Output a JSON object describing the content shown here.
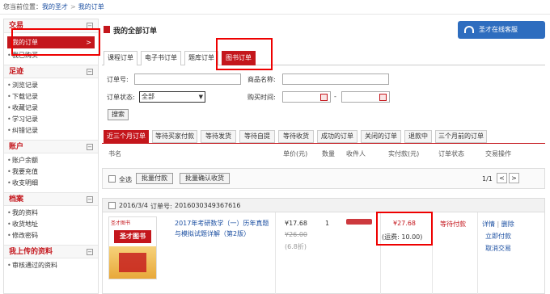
{
  "breadcrumb": {
    "prefix": "您当前位置：",
    "home": "我的圣才",
    "sep": ">",
    "current": "我的订单"
  },
  "sidebar": {
    "sections": [
      {
        "title": "交易",
        "toggle": "⊟",
        "items": [
          {
            "label": "我的订单",
            "active": true,
            "arrow": ">"
          },
          {
            "label": "我已购买"
          }
        ]
      },
      {
        "title": "足迹",
        "toggle": "⊟",
        "items": [
          {
            "label": "浏览记录"
          },
          {
            "label": "下载记录"
          },
          {
            "label": "收藏记录"
          },
          {
            "label": "学习记录"
          },
          {
            "label": "纠错记录"
          }
        ]
      },
      {
        "title": "账户",
        "toggle": "⊟",
        "items": [
          {
            "label": "账户余额"
          },
          {
            "label": "我要充值"
          },
          {
            "label": "收支明细"
          }
        ]
      },
      {
        "title": "档案",
        "toggle": "⊟",
        "items": [
          {
            "label": "我的资料"
          },
          {
            "label": "收货地址"
          },
          {
            "label": "修改密码"
          }
        ]
      },
      {
        "title": "我上传的资料",
        "toggle": "⊟",
        "items": [
          {
            "label": "审核通过的资料"
          }
        ]
      }
    ]
  },
  "main": {
    "title": "我的全部订单",
    "service_button": "圣才在线客服",
    "type_tabs": [
      "课程订单",
      "电子书订单",
      "题库订单",
      "图书订单"
    ],
    "filters": {
      "order_no_label": "订单号:",
      "product_name_label": "商品名称:",
      "status_label": "订单状态:",
      "status_value": "全部",
      "buy_time_label": "购买时间:",
      "range_sep": "-",
      "search_button": "搜索"
    },
    "order_tabs": [
      "近三个月订单",
      "等待买家付款",
      "等待发货",
      "等待自提",
      "等待收货",
      "成功的订单",
      "关闭的订单",
      "退款中",
      "三个月前的订单"
    ],
    "columns": [
      "书名",
      "单价(元)",
      "数量",
      "收件人",
      "实付款(元)",
      "订单状态",
      "交易操作"
    ],
    "batch": {
      "select_all": "全选",
      "batch_pay": "批量付款",
      "batch_confirm": "批量确认收货",
      "page": "1/1",
      "prev": "<",
      "next": ">"
    },
    "order": {
      "date": "2016/3/4",
      "order_no_label": "订单号:",
      "order_no": "2016030349367616",
      "book_cover_logo": "圣才图书",
      "book_cover_title": "圣才图书",
      "book_title": "2017年考研数学（一）历年真题与模拟试题详解（第2版）",
      "price": "¥17.68",
      "orig_price": "¥26.00",
      "discount": "(6.8折)",
      "qty": "1",
      "paid": "¥27.68",
      "shipping": "(运费: 10.00)",
      "status": "等待付款",
      "actions": {
        "detail": "详情",
        "sep": "|",
        "delete": "删除",
        "pay": "立即付款",
        "cancel": "取消交易"
      }
    }
  },
  "colors": {
    "brand_red": "#c4161c",
    "link_blue": "#1d50a2",
    "service_blue": "#2e6dbf",
    "highlight_box": "#e00000"
  }
}
